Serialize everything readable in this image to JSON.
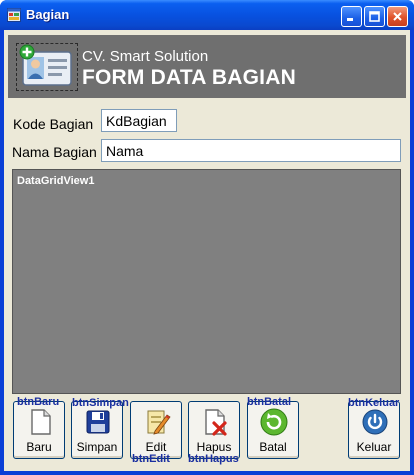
{
  "window": {
    "title": "Bagian"
  },
  "header": {
    "company": "CV. Smart Solution",
    "form_title": "FORM DATA BAGIAN"
  },
  "fields": {
    "kode_label": "Kode Bagian",
    "kode_value": "KdBagian",
    "nama_label": "Nama Bagian",
    "nama_value": "Nama"
  },
  "grid": {
    "name": "DataGridView1"
  },
  "buttons": [
    {
      "label": "Baru",
      "name": "btnBaru",
      "icon": "new-document-icon"
    },
    {
      "label": "Simpan",
      "name": "btnSimpan",
      "icon": "floppy-disk-icon"
    },
    {
      "label": "Edit",
      "name": "btnEdit",
      "icon": "edit-pencil-icon"
    },
    {
      "label": "Hapus",
      "name": "btnHapus",
      "icon": "delete-document-icon"
    },
    {
      "label": "Batal",
      "name": "btnBatal",
      "icon": "refresh-icon"
    },
    {
      "label": "Keluar",
      "name": "btnKeluar",
      "icon": "power-icon"
    }
  ],
  "colors": {
    "titlebar": "#0a50de",
    "client_bg": "#ece9d8",
    "header_panel": "#6f6f6f",
    "grid_bg": "#808080",
    "button_name_text": "#1a2fa0"
  }
}
